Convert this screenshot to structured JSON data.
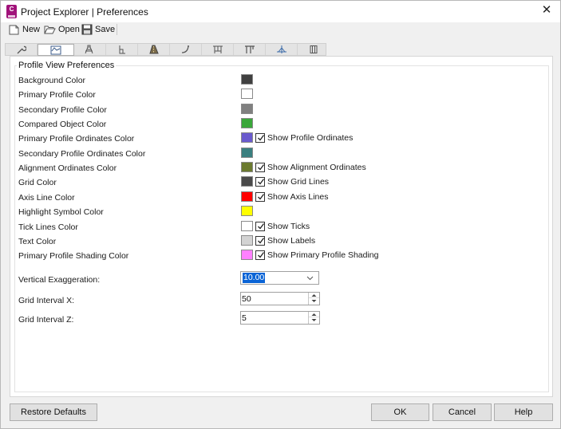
{
  "window": {
    "title": "Project Explorer | Preferences",
    "app_icon_letter": "C"
  },
  "toolbar": {
    "new_label": "New",
    "open_label": "Open",
    "save_label": "Save"
  },
  "tabs": [
    {
      "icon": "wrench-icon"
    },
    {
      "icon": "profile-view-icon",
      "active": true
    },
    {
      "icon": "corridor-icon"
    },
    {
      "icon": "sample-line-icon"
    },
    {
      "icon": "road-shape-icon"
    },
    {
      "icon": "curve-icon"
    },
    {
      "icon": "structure-icon"
    },
    {
      "icon": "pipe-structure-icon"
    },
    {
      "icon": "plan-icon"
    },
    {
      "icon": "columns-icon"
    }
  ],
  "group": {
    "title": "Profile View Preferences"
  },
  "rows": [
    {
      "label": "Background Color",
      "color": "#404040"
    },
    {
      "label": "Primary Profile Color",
      "color": "#ffffff"
    },
    {
      "label": "Secondary Profile Color",
      "color": "#808080"
    },
    {
      "label": "Compared Object Color",
      "color": "#3aa73a"
    },
    {
      "label": "Primary Profile Ordinates Color",
      "color": "#6a5acd",
      "checkbox_label": "Show Profile Ordinates",
      "checked": true
    },
    {
      "label": "Secondary Profile Ordinates Color",
      "color": "#3a7f7f"
    },
    {
      "label": "Alignment Ordinates Color",
      "color": "#6b7a2f",
      "checkbox_label": "Show Alignment Ordinates",
      "checked": true
    },
    {
      "label": "Grid Color",
      "color": "#4a4a4a",
      "checkbox_label": "Show Grid Lines",
      "checked": true
    },
    {
      "label": "Axis Line Color",
      "color": "#ff0000",
      "checkbox_label": "Show Axis Lines",
      "checked": true
    },
    {
      "label": "Highlight Symbol Color",
      "color": "#ffff00"
    },
    {
      "label": "Tick Lines Color",
      "color": "#ffffff",
      "checkbox_label": "Show Ticks",
      "checked": true
    },
    {
      "label": "Text Color",
      "color": "#d3d3d3",
      "checkbox_label": "Show Labels",
      "checked": true
    },
    {
      "label": "Primary Profile Shading Color",
      "color": "#ff80ff",
      "checkbox_label": "Show Primary Profile Shading",
      "checked": true
    }
  ],
  "settings": {
    "vertical_exaggeration": {
      "label": "Vertical Exaggeration:",
      "value": "10.00"
    },
    "grid_interval_x": {
      "label": "Grid Interval X:",
      "value": "50"
    },
    "grid_interval_z": {
      "label": "Grid Interval Z:",
      "value": "5"
    }
  },
  "buttons": {
    "restore": "Restore Defaults",
    "ok": "OK",
    "cancel": "Cancel",
    "help": "Help"
  }
}
